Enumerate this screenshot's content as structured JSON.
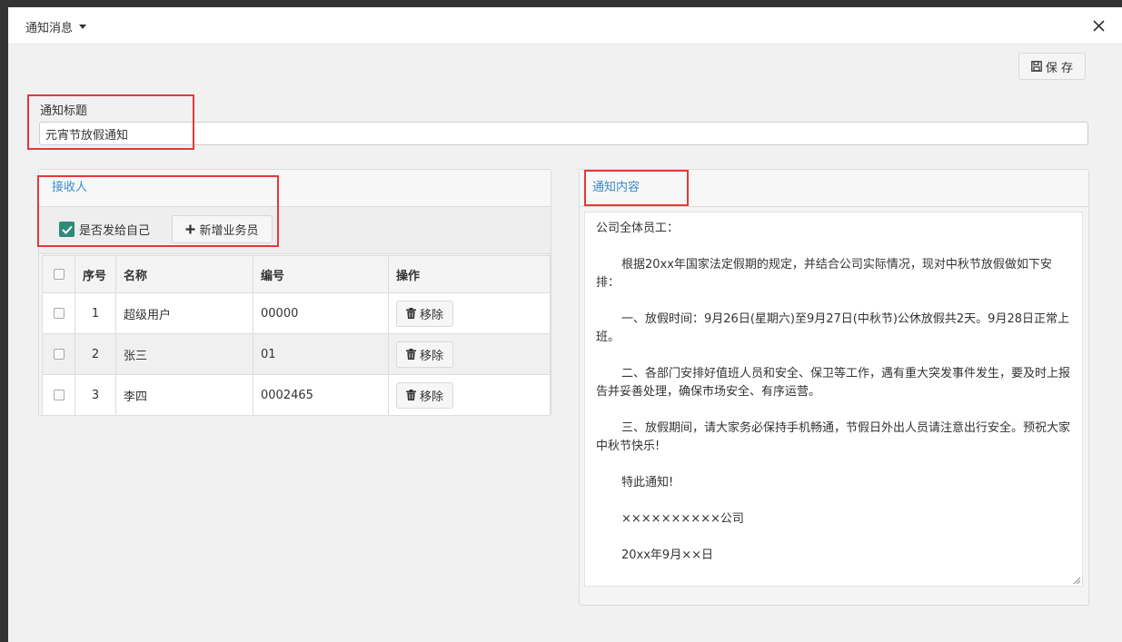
{
  "modal": {
    "title": "通知消息",
    "save_label": "保 存"
  },
  "form": {
    "title_label": "通知标题",
    "title_value": "元宵节放假通知"
  },
  "recipients": {
    "panel_title": "接收人",
    "send_self_label": "是否发给自己",
    "send_self_checked": true,
    "add_button_label": "新增业务员",
    "columns": [
      "序号",
      "名称",
      "编号",
      "操作"
    ],
    "remove_label": "移除",
    "rows": [
      {
        "index": "1",
        "name": "超级用户",
        "code": "00000"
      },
      {
        "index": "2",
        "name": "张三",
        "code": "01"
      },
      {
        "index": "3",
        "name": "李四",
        "code": "0002465"
      }
    ]
  },
  "content": {
    "panel_title": "通知内容",
    "paragraphs": [
      "公司全体员工：",
      "根据20xx年国家法定假期的规定，并结合公司实际情况，现对中秋节放假做如下安排：",
      "一、放假时间：9月26日(星期六)至9月27日(中秋节)公休放假共2天。9月28日正常上班。",
      "二、各部门安排好值班人员和安全、保卫等工作，遇有重大突发事件发生，要及时上报告并妥善处理，确保市场安全、有序运营。",
      "三、放假期间，请大家务必保持手机畅通，节假日外出人员请注意出行安全。预祝大家中秋节快乐!",
      "特此通知!",
      "××××××××××公司",
      "20xx年9月××日"
    ]
  },
  "colors": {
    "accent_link": "#3a8bc9",
    "highlight_border": "#e8363a",
    "checkbox_green": "#2e8b7a"
  }
}
